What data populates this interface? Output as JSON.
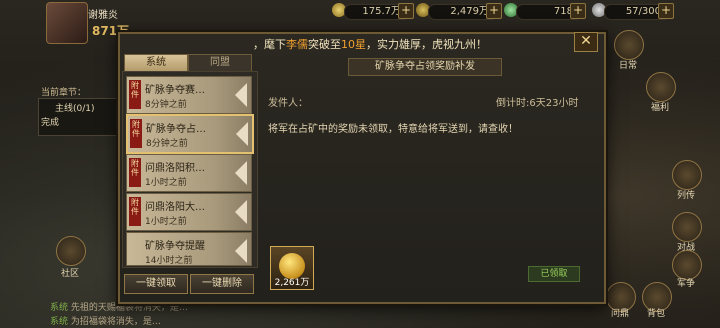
{
  "topbar": {
    "player_name": "谢雅炎",
    "power": "871万",
    "resources": [
      {
        "name": "copper",
        "value": "175.7万",
        "icon": "copper-coin-icon"
      },
      {
        "name": "grain",
        "value": "2,479万",
        "icon": "grain-icon"
      },
      {
        "name": "gold",
        "value": "718",
        "icon": "gold-ingot-icon"
      },
      {
        "name": "stamina",
        "value": "57/300",
        "icon": "stamina-icon"
      }
    ]
  },
  "banner": {
    "prefix": "，麾下",
    "hero": "李儒",
    "middle": "突破至",
    "stars": "10星",
    "suffix": "，实力雄厚，虎视九州！"
  },
  "tabs": [
    {
      "label": "系统"
    },
    {
      "label": "同盟"
    }
  ],
  "mails": [
    {
      "tag": "附件",
      "title": "矿脉争夺赛…",
      "time": "8分钟之前"
    },
    {
      "tag": "附件",
      "title": "矿脉争夺占…",
      "time": "8分钟之前"
    },
    {
      "tag": "附件",
      "title": "问鼎洛阳积…",
      "time": "1小时之前"
    },
    {
      "tag": "附件",
      "title": "问鼎洛阳大…",
      "time": "1小时之前"
    },
    {
      "tag": "",
      "title": "矿脉争夺提醒",
      "time": "14小时之前"
    }
  ],
  "buttons": {
    "claim_all": "一键领取",
    "delete_all": "一键删除",
    "claimed": "已领取"
  },
  "mail_detail": {
    "title": "矿脉争夺占领奖励补发",
    "sender": "发件人：",
    "countdown": "倒计时:6天23小时",
    "body": "将军在占矿中的奖励未领取，特意给将军送到，请查收！",
    "reward_qty": "2,261万"
  },
  "left": {
    "chapter_label": "当前章节：",
    "mainline": "主线(0/1)",
    "complete": "完成",
    "chat": [
      {
        "tag": "系统",
        "text": "先祖的天赐福袋将消失，是…"
      },
      {
        "tag": "系统",
        "text": "为招福袋将消失，是…"
      }
    ],
    "community": "社区"
  },
  "right_side": {
    "labels": [
      "日常",
      "福利",
      "列传",
      "对战",
      "军争",
      "问鼎",
      "背包"
    ]
  }
}
